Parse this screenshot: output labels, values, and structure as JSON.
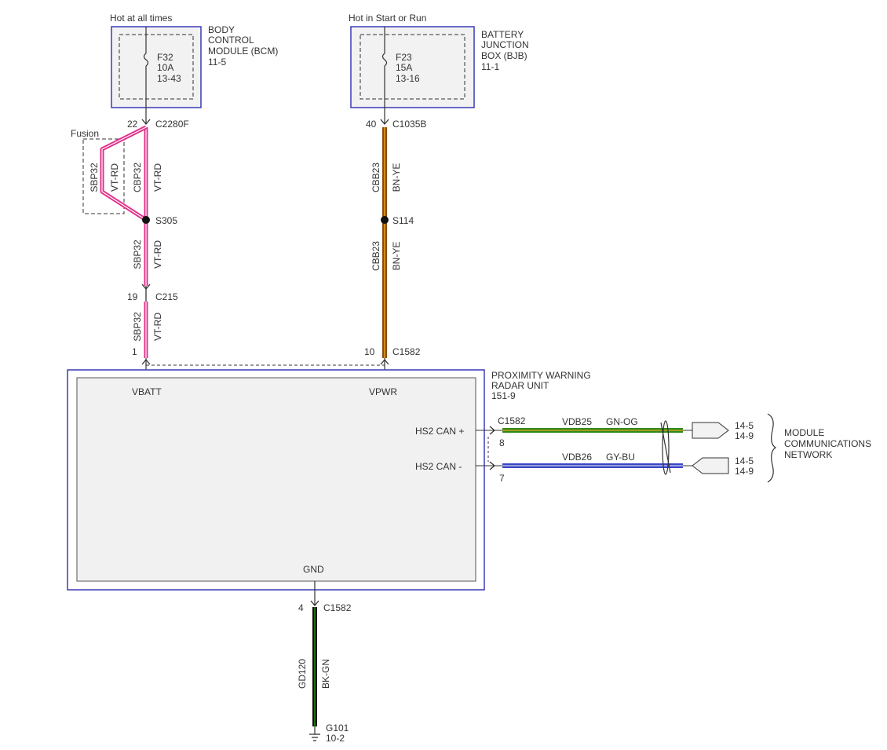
{
  "top_labels": {
    "left": "Hot at all times",
    "right": "Hot in Start or Run"
  },
  "bcm": {
    "name_lines": [
      "BODY",
      "CONTROL",
      "MODULE (BCM)",
      "11-5"
    ],
    "fuse_lines": [
      "F32",
      "10A",
      "13-43"
    ]
  },
  "bjb": {
    "name_lines": [
      "BATTERY",
      "JUNCTION",
      "BOX (BJB)",
      "11-1"
    ],
    "fuse_lines": [
      "F23",
      "15A",
      "13-16"
    ]
  },
  "left_circuit": {
    "c2280f_pin": "22",
    "c2280f_name": "C2280F",
    "fusion_label": "Fusion",
    "fusion_circuit": "SBP32",
    "fusion_color": "VT-RD",
    "upper_circuit": "CBP32",
    "upper_color": "VT-RD",
    "splice": "S305",
    "mid_circuit": "SBP32",
    "mid_color": "VT-RD",
    "c215_pin": "19",
    "c215_name": "C215",
    "low_circuit": "SBP32",
    "low_color": "VT-RD",
    "module_pin": "1"
  },
  "right_circuit": {
    "c1035b_pin": "40",
    "c1035b_name": "C1035B",
    "upper_circuit": "CBB23",
    "upper_color": "BN-YE",
    "splice": "S114",
    "low_circuit": "CBB23",
    "low_color": "BN-YE",
    "module_pin": "10",
    "module_connector": "C1582"
  },
  "module": {
    "name_lines": [
      "PROXIMITY WARNING",
      "RADAR UNIT",
      "151-9"
    ],
    "vbatt": "VBATT",
    "vpwr": "VPWR",
    "gnd": "GND",
    "can_plus": "HS2 CAN +",
    "can_minus": "HS2 CAN -"
  },
  "can": {
    "connector": "C1582",
    "plus_pin": "8",
    "minus_pin": "7",
    "plus_circuit": "VDB25",
    "plus_color": "GN-OG",
    "minus_circuit": "VDB26",
    "minus_color": "GY-BU",
    "plus_ref_lines": [
      "14-5",
      "14-9"
    ],
    "minus_ref_lines": [
      "14-5",
      "14-9"
    ],
    "network_lines": [
      "MODULE",
      "COMMUNICATIONS",
      "NETWORK"
    ]
  },
  "ground": {
    "pin": "4",
    "connector": "C1582",
    "circuit": "GD120",
    "color": "BK-GN",
    "ground_name": "G101",
    "ground_ref": "10-2"
  },
  "colors": {
    "module_border": "#3a3ab8",
    "vt_rd": "#e0308a",
    "bn_ye": "#8a4a10",
    "bn_ye_stripe": "#e8a020",
    "gn_og": "#2e8a1a",
    "gy_bu": "#3a46c8",
    "bk_gn": "#111111"
  }
}
